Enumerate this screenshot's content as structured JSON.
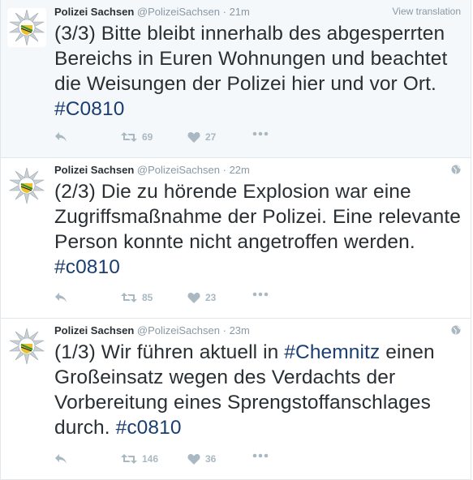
{
  "tweets": [
    {
      "name": "Polizei Sachsen",
      "handle": "@PolizeiSachsen",
      "sep": "·",
      "time": "21m",
      "translate": "View translation",
      "text_before": "(3/3) Bitte bleibt innerhalb des abgesperrten Bereichs in Euren Wohnungen und beachtet die Weisungen der Polizei hier und vor Ort. ",
      "hashtag": "#C0810",
      "text_after": "",
      "retweets": "69",
      "likes": "27"
    },
    {
      "name": "Polizei Sachsen",
      "handle": "@PolizeiSachsen",
      "sep": "·",
      "time": "22m",
      "text_before": "(2/3) Die zu hörende Explosion war eine Zugriffsmaßnahme der Polizei. Eine relevante Person konnte nicht angetroffen werden. ",
      "hashtag": "#c0810",
      "text_after": "",
      "retweets": "85",
      "likes": "23"
    },
    {
      "name": "Polizei Sachsen",
      "handle": "@PolizeiSachsen",
      "sep": "·",
      "time": "23m",
      "text_before": "(1/3) Wir führen aktuell in ",
      "hashtag": "#Chemnitz",
      "text_middle": " einen Großeinsatz wegen des Verdachts der Vorbereitung eines Sprengstoffanschlages durch. ",
      "hashtag2": "#c0810",
      "retweets": "146",
      "likes": "36"
    }
  ],
  "icons": {
    "reply": "reply-icon",
    "retweet": "retweet-icon",
    "like": "heart-icon",
    "more": "more-icon",
    "globe": "globe-icon",
    "avatar": "police-star-badge"
  },
  "colors": {
    "hashtag": "#1b3e70",
    "meta": "#8899a6",
    "text": "#292f33",
    "action": "#aab8c2",
    "badge_green": "#2e8b3a",
    "badge_gold": "#e8c22a"
  }
}
